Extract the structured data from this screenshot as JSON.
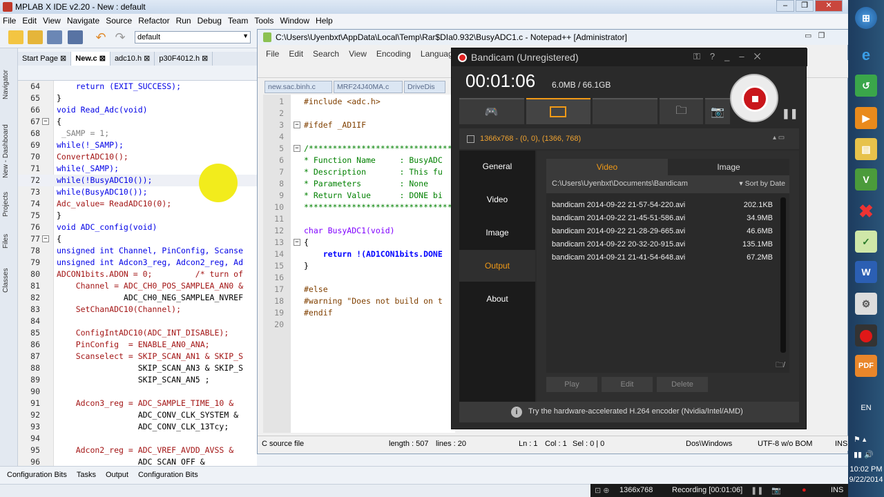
{
  "mplab": {
    "title": "MPLAB X IDE v2.20 - New : default",
    "menu": [
      "File",
      "Edit",
      "View",
      "Navigate",
      "Source",
      "Refactor",
      "Run",
      "Debug",
      "Team",
      "Tools",
      "Window",
      "Help"
    ],
    "config_value": "default",
    "side_tabs": [
      "Navigator",
      "New - Dashboard",
      "Projects",
      "Files",
      "Classes"
    ],
    "tabs": [
      "Start Page",
      "New.c",
      "adc10.h",
      "p30F4012.h"
    ],
    "bottom_tabs": [
      "Configuration Bits",
      "Tasks",
      "Output",
      "Configuration Bits"
    ],
    "code": [
      {
        "n": "64",
        "t": "    return (EXIT_SUCCESS);"
      },
      {
        "n": "65",
        "t": "}"
      },
      {
        "n": "66",
        "t": "void Read_Adc(void)"
      },
      {
        "n": "67",
        "t": "{"
      },
      {
        "n": "68",
        "t": " _SAMP = 1;"
      },
      {
        "n": "69",
        "t": "while(!_SAMP);"
      },
      {
        "n": "70",
        "t": "ConvertADC10();"
      },
      {
        "n": "71",
        "t": "while(_SAMP);"
      },
      {
        "n": "72",
        "t": "while(!BusyADC10());"
      },
      {
        "n": "73",
        "t": "while(BusyADC10());"
      },
      {
        "n": "74",
        "t": "Adc_value= ReadADC10(0);"
      },
      {
        "n": "75",
        "t": "}"
      },
      {
        "n": "76",
        "t": "void ADC_config(void)"
      },
      {
        "n": "77",
        "t": "{"
      },
      {
        "n": "78",
        "t": "unsigned int Channel, PinConfig, Scanse"
      },
      {
        "n": "79",
        "t": "unsigned int Adcon3_reg, Adcon2_reg, Ad"
      },
      {
        "n": "80",
        "t": "ADCON1bits.ADON = 0;         /* turn of"
      },
      {
        "n": "81",
        "t": "    Channel = ADC_CH0_POS_SAMPLEA_AN0 &"
      },
      {
        "n": "82",
        "t": "              ADC_CH0_NEG_SAMPLEA_NVREF"
      },
      {
        "n": "83",
        "t": "    SetChanADC10(Channel);"
      },
      {
        "n": "84",
        "t": ""
      },
      {
        "n": "85",
        "t": "    ConfigIntADC10(ADC_INT_DISABLE);"
      },
      {
        "n": "86",
        "t": "    PinConfig  = ENABLE_AN0_ANA;"
      },
      {
        "n": "87",
        "t": "    Scanselect = SKIP_SCAN_AN1 & SKIP_S"
      },
      {
        "n": "88",
        "t": "                 SKIP_SCAN_AN3 & SKIP_S"
      },
      {
        "n": "89",
        "t": "                 SKIP_SCAN_AN5 ;"
      },
      {
        "n": "90",
        "t": ""
      },
      {
        "n": "91",
        "t": "    Adcon3_reg = ADC_SAMPLE_TIME_10 &"
      },
      {
        "n": "92",
        "t": "                 ADC_CONV_CLK_SYSTEM &"
      },
      {
        "n": "93",
        "t": "                 ADC_CONV_CLK_13Tcy;"
      },
      {
        "n": "94",
        "t": ""
      },
      {
        "n": "95",
        "t": "    Adcon2_reg = ADC_VREF_AVDD_AVSS &"
      },
      {
        "n": "96",
        "t": "                 ADC_SCAN_OFF &"
      }
    ]
  },
  "npp": {
    "title": "C:\\Users\\Uyenbxt\\AppData\\Local\\Temp\\Rar$DIa0.932\\BusyADC1.c - Notepad++ [Administrator]",
    "menu": [
      "File",
      "Edit",
      "Search",
      "View",
      "Encoding",
      "Language"
    ],
    "tabs": [
      "new.sac.binh.c",
      "MRF24J40MA.c",
      "DriveDis"
    ],
    "code": [
      {
        "n": "1",
        "t": "#include <adc.h>"
      },
      {
        "n": "2",
        "t": ""
      },
      {
        "n": "3",
        "t": "#ifdef _AD1IF"
      },
      {
        "n": "4",
        "t": ""
      },
      {
        "n": "5",
        "t": "/*********************************************"
      },
      {
        "n": "6",
        "t": "* Function Name     : BusyADC"
      },
      {
        "n": "7",
        "t": "* Description       : This fu"
      },
      {
        "n": "8",
        "t": "* Parameters        : None"
      },
      {
        "n": "9",
        "t": "* Return Value      : DONE bi"
      },
      {
        "n": "10",
        "t": "***********************************************"
      },
      {
        "n": "11",
        "t": ""
      },
      {
        "n": "12",
        "t": "char BusyADC1(void)"
      },
      {
        "n": "13",
        "t": "{"
      },
      {
        "n": "14",
        "t": "    return !(AD1CON1bits.DONE"
      },
      {
        "n": "15",
        "t": "}"
      },
      {
        "n": "16",
        "t": ""
      },
      {
        "n": "17",
        "t": "#else"
      },
      {
        "n": "18",
        "t": "#warning \"Does not build on t"
      },
      {
        "n": "19",
        "t": "#endif"
      },
      {
        "n": "20",
        "t": ""
      }
    ],
    "status": {
      "type": "C source file",
      "length": "length : 507",
      "lines": "lines : 20",
      "ln": "Ln : 1",
      "col": "Col : 1",
      "sel": "Sel : 0 | 0",
      "eol": "Dos\\Windows",
      "enc": "UTF-8 w/o BOM",
      "ins": "INS"
    }
  },
  "bandicam": {
    "title": "Bandicam (Unregistered)",
    "timer": "00:01:06",
    "size": "6.0MB / 66.1GB",
    "area": "1366x768 - (0, 0), (1366, 768)",
    "nav": [
      "General",
      "Video",
      "Image",
      "Output",
      "About"
    ],
    "subtabs": [
      "Video",
      "Image"
    ],
    "path": "C:\\Users\\Uyenbxt\\Documents\\Bandicam",
    "sort": "Sort by Date",
    "files": [
      {
        "name": "bandicam 2014-09-22 21-57-54-220.avi",
        "size": "202.1KB"
      },
      {
        "name": "bandicam 2014-09-22 21-45-51-586.avi",
        "size": "34.9MB"
      },
      {
        "name": "bandicam 2014-09-22 21-28-29-665.avi",
        "size": "46.6MB"
      },
      {
        "name": "bandicam 2014-09-22 20-32-20-915.avi",
        "size": "135.1MB"
      },
      {
        "name": "bandicam 2014-09-21 21-41-54-648.avi",
        "size": "67.2MB"
      }
    ],
    "buttons": [
      "Play",
      "Edit",
      "Delete"
    ],
    "footer": "Try the hardware-accelerated H.264 encoder (Nvidia/Intel/AMD)",
    "accent": "#f19a17"
  },
  "taskbar": {
    "lang": "EN",
    "time": "10:02 PM",
    "date": "9/22/2014"
  },
  "recbar": {
    "resolution": "1366x768",
    "status": "Recording [00:01:06]",
    "ins": "INS"
  }
}
